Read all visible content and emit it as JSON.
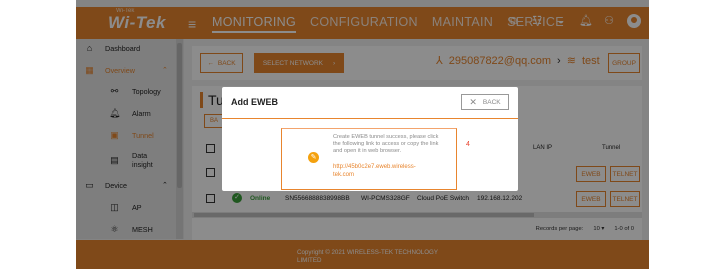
{
  "header": {
    "logo": "Wi-Tek",
    "logo_tag": "Wi-Tek",
    "nav": [
      "MONITORING",
      "CONFIGURATION",
      "MAINTAIN",
      "SERVICE"
    ]
  },
  "sidebar": {
    "items": [
      {
        "label": "Dashboard",
        "icon": "home-icon"
      },
      {
        "label": "Overview",
        "icon": "overview-icon"
      },
      {
        "label": "Topology",
        "icon": "topology-icon"
      },
      {
        "label": "Alarm",
        "icon": "bell-icon"
      },
      {
        "label": "Tunnel",
        "icon": "tunnel-icon"
      },
      {
        "label": "Data\ninsight",
        "icon": "data-insight-icon"
      },
      {
        "label": "Device",
        "icon": "monitor-icon"
      },
      {
        "label": "AP",
        "icon": "ap-icon"
      },
      {
        "label": "MESH",
        "icon": "mesh-icon"
      }
    ]
  },
  "toolbar": {
    "back_label": "BACK",
    "select_network_label": "SELECT NETWORK",
    "account": "295087822@qq.com",
    "network": "test",
    "group_label": "GROUP"
  },
  "panel": {
    "title": "Tun",
    "add_label": "BA",
    "columns": {
      "lan_ip": "LAN IP",
      "tunnel": "Tunnel"
    },
    "row": {
      "status": "Online",
      "sn": "SN5566888838998BB",
      "model": "WI-PCMS328GF",
      "type": "Cloud PoE Switch",
      "ip": "192.168.12.202",
      "eweb_label": "EWEB",
      "telnet_label": "TELNET"
    },
    "row0_buttons": {
      "eweb_label": "EWEB",
      "telnet_label": "TELNET"
    },
    "pager": {
      "rows_label": "Records per page:",
      "rows_value": "10",
      "range": "1-0 of 0"
    }
  },
  "footer": {
    "copyright": "Copyright © 2021 WIRELESS-TEK TECHNOLOGY LIMITED"
  },
  "modal": {
    "title": "Add EWEB",
    "close_label": "BACK",
    "message": "Create EWEB tunnel success, please click the following link to access or copy the link and open it in web browser.",
    "link": "http://45b0c2e7.eweb.wireless-tek.com",
    "annotation": "4"
  },
  "colors": {
    "brand": "#e8852e",
    "online": "#3a9e3a"
  }
}
